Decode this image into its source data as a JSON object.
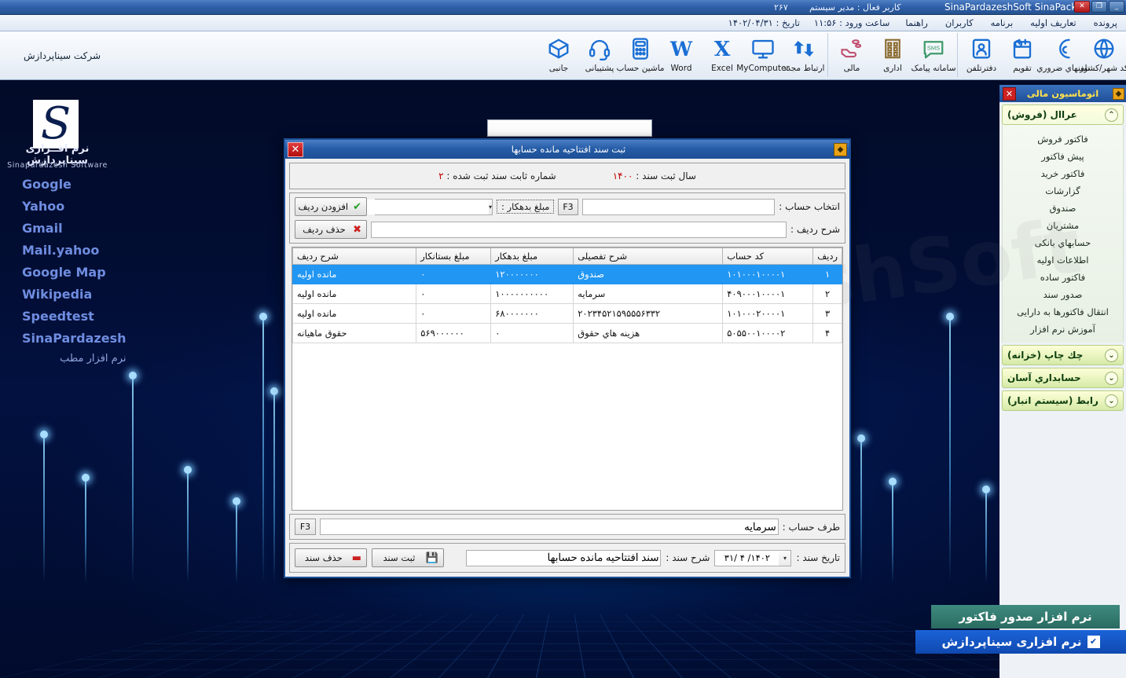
{
  "titlebar": {
    "app_name": "SinaPardazeshSoft SinaPack",
    "active_user": "کاربر فعال : مدیر سیستم",
    "number": "۲۶۷",
    "minimize": "_",
    "restore": "❐",
    "close": "✕"
  },
  "menubar": {
    "items": [
      {
        "label": "پرونده"
      },
      {
        "label": "تعاریف اولیه"
      },
      {
        "label": "برنامه"
      },
      {
        "label": "کاربران"
      },
      {
        "label": "راهنما"
      }
    ],
    "login_time": "ساعت ورود : ۱۱:۵۶",
    "date": "تاریخ : ۱۴۰۲/۰۴/۳۱"
  },
  "toolbar": {
    "company": "شرکت سیناپردازش",
    "group_left": [
      {
        "label": "ارتباط مجدد",
        "icon": "refresh-icon",
        "lang": "fa"
      },
      {
        "label": "MyComputer",
        "icon": "monitor-icon",
        "lang": "en"
      },
      {
        "label": "Excel",
        "icon": "excel-icon",
        "lang": "en"
      },
      {
        "label": "Word",
        "icon": "word-icon",
        "lang": "en"
      },
      {
        "label": "ماشین حساب",
        "icon": "calculator-icon",
        "lang": "fa"
      },
      {
        "label": "پشتیبانی",
        "icon": "headset-icon",
        "lang": "fa"
      },
      {
        "label": "جانبی",
        "icon": "box-icon",
        "lang": "fa"
      }
    ],
    "group_mid": [
      {
        "label": "سامانه پیامک",
        "icon": "sms-icon",
        "lang": "fa"
      },
      {
        "label": "اداری",
        "icon": "building-icon",
        "lang": "fa"
      },
      {
        "label": "مالی",
        "icon": "hand-coins-icon",
        "lang": "fa"
      }
    ],
    "group_right": [
      {
        "label": "کد شهر/کشور",
        "icon": "globe-icon",
        "lang": "fa"
      },
      {
        "label": "تلفنهاي ضروري",
        "icon": "phone-icon",
        "lang": "fa"
      },
      {
        "label": "تقویم",
        "icon": "calendar-icon",
        "lang": "fa"
      },
      {
        "label": "دفترتلفن",
        "icon": "contact-card-icon",
        "lang": "fa"
      }
    ]
  },
  "desktop": {
    "logo_letter": "S",
    "logo_fa": "نرم افــزاری سیناپردازش",
    "logo_en": "Sinapardazesh Software",
    "links": [
      {
        "label": "Google",
        "lang": "en"
      },
      {
        "label": "Yahoo",
        "lang": "en"
      },
      {
        "label": "Gmail",
        "lang": "en"
      },
      {
        "label": "Mail.yahoo",
        "lang": "en"
      },
      {
        "label": "Google Map",
        "lang": "en"
      },
      {
        "label": "Wikipedia",
        "lang": "en"
      },
      {
        "label": "Speedtest",
        "lang": "en"
      },
      {
        "label": "SinaPardazesh",
        "lang": "en"
      },
      {
        "label": "نرم افزار مطب",
        "lang": "fa"
      }
    ]
  },
  "sidebar": {
    "title": "اتوماسیون مالی",
    "badge_icon": "diamond-icon",
    "close_icon": "close-icon",
    "groups": [
      {
        "label": "عراال (فروش)",
        "expanded": true,
        "chevron": "⌃",
        "items": [
          {
            "label": "فاکتور فروش"
          },
          {
            "label": "پیش فاکتور"
          },
          {
            "label": "فاکتور خرید"
          },
          {
            "label": "گزارشات"
          },
          {
            "label": "صندوق"
          },
          {
            "label": "مشتریان"
          },
          {
            "label": "حسابهاي بانکی"
          },
          {
            "label": "اطلاعات اولیه"
          },
          {
            "label": "فاکتور ساده"
          },
          {
            "label": "صدور سند"
          },
          {
            "label": "انتقال فاکتورها به دارایی"
          },
          {
            "label": "آموزش نرم افزار"
          }
        ]
      },
      {
        "label": "چك چاپ (خزانه)",
        "expanded": false,
        "chevron": "⌄",
        "items": []
      },
      {
        "label": "حسابداري آسان",
        "expanded": false,
        "chevron": "⌄",
        "items": []
      },
      {
        "label": "رابط (سیستم انبار)",
        "expanded": false,
        "chevron": "⌄",
        "items": []
      }
    ]
  },
  "banners": {
    "banner_top": "نرم افزار صدور فاکتور",
    "banner_bottom": "نرم افزاری سیناپردازش",
    "banner_bottom_icon": "check-icon"
  },
  "dialog": {
    "title": "ثبت سند افتتاحیه مانده حسابها",
    "icon": "diamond-icon",
    "close": "✕",
    "watermark": "SinaPardazeshSoft",
    "info": {
      "fixed_number_label": "شماره ثابت سند ثبت شده :",
      "fixed_number_value": "۲",
      "year_label": "سال ثبت سند :",
      "year_value": "۱۴۰۰"
    },
    "form": {
      "account_label": "انتخاب حساب :",
      "account_value": "",
      "f3_key": "F3",
      "amount_label": "مبلغ بدهکار :",
      "amount_value": "",
      "row_desc_label": "شرح ردیف :",
      "row_desc_value": "",
      "add_row_button": "افزودن ردیف",
      "add_row_icon": "check-icon",
      "delete_row_button": "حذف ردیف",
      "delete_row_icon": "x-icon"
    },
    "table": {
      "columns": [
        {
          "key": "idx",
          "label": "ردیف"
        },
        {
          "key": "code",
          "label": "کد حساب"
        },
        {
          "key": "desc",
          "label": "شرح تفصیلی"
        },
        {
          "key": "debit",
          "label": "مبلغ بدهکار"
        },
        {
          "key": "credit",
          "label": "مبلغ بستانکار"
        },
        {
          "key": "rdesc",
          "label": "شرح ردیف"
        }
      ],
      "rows": [
        {
          "idx": "۱",
          "code": "۱۰۱۰۰۰۱۰۰۰۰۱",
          "desc": "صندوق",
          "debit": "۱۲۰۰۰۰۰۰۰",
          "credit": "۰",
          "rdesc": "مانده اولیه",
          "selected": true
        },
        {
          "idx": "۲",
          "code": "۴۰۹۰۰۰۱۰۰۰۰۱",
          "desc": "سرمایه",
          "debit": "۱۰۰۰۰۰۰۰۰۰۰",
          "credit": "۰",
          "rdesc": "مانده اولیه",
          "selected": false
        },
        {
          "idx": "۳",
          "code": "۱۰۱۰۰۰۲۰۰۰۰۱",
          "desc": "۲۰۲۳۴۵۲۱۵۹۵۵۵۶۳۳۲",
          "debit": "۶۸۰۰۰۰۰۰۰",
          "credit": "۰",
          "rdesc": "مانده اولیه",
          "selected": false
        },
        {
          "idx": "۴",
          "code": "۵۰۵۵۰۰۱۰۰۰۰۲",
          "desc": "هزینه هاي حقوق",
          "debit": "۰",
          "credit": "۵۶۹۰۰۰۰۰۰",
          "rdesc": "حقوق ماهیانه",
          "selected": false
        }
      ]
    },
    "counterparty": {
      "label": "طرف حساب :",
      "value": "سرمایه",
      "f3_key": "F3"
    },
    "bottom": {
      "date_label": "تاریخ سند :",
      "date_value": "۱۴۰۲/ ۴ /۳۱",
      "doc_desc_label": "شرح سند :",
      "doc_desc_value": "سند افتتاحیه مانده حسابها",
      "save_button": "ثبت سند",
      "save_icon": "save-icon",
      "delete_button": "حذف سند",
      "delete_icon": "minus-icon"
    }
  },
  "colors": {
    "accent_blue": "#1d4f96",
    "selection_blue": "#2196f3",
    "title_yellow": "#ffe14d",
    "red": "#c00000",
    "link_blue": "#6f8de0"
  }
}
